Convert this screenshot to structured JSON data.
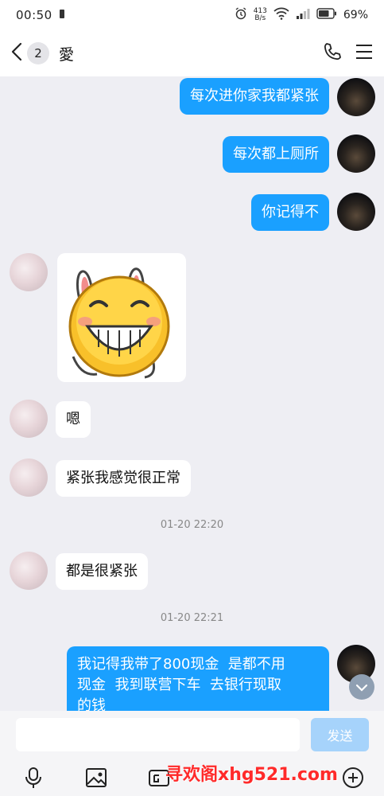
{
  "status_bar": {
    "time": "00:50",
    "net_speed_value": "413",
    "net_speed_unit": "B/s",
    "battery": "69%"
  },
  "header": {
    "unread_count": "2",
    "contact_name": "愛"
  },
  "messages": [
    {
      "side": "out",
      "text": "每次进你家我都紧张"
    },
    {
      "side": "out",
      "text": "每次都上厕所"
    },
    {
      "side": "out",
      "text": "你记得不"
    },
    {
      "side": "in",
      "type": "sticker",
      "sticker": "grinning-bunny-emoji"
    },
    {
      "side": "in",
      "text": "嗯"
    },
    {
      "side": "in",
      "text": "紧张我感觉很正常"
    },
    {
      "side": "in",
      "text": "都是很紧张"
    },
    {
      "side": "out",
      "text": "我记得我带了800现金  是都不用\n现金  我到联营下车  去银行现取\n的钱"
    }
  ],
  "timestamps": [
    "01-20 22:20",
    "01-20 22:21"
  ],
  "input": {
    "value": "",
    "placeholder": "",
    "send_label": "发送"
  },
  "toolbar": {
    "icons": [
      "microphone-icon",
      "image-icon",
      "gif-icon",
      "watermark",
      "add-icon"
    ]
  },
  "watermark": "寻欢阁xhg521.com",
  "colors": {
    "outgoing_bubble": "#1aa0ff",
    "incoming_bubble": "#ffffff",
    "chat_background": "#eeeef3",
    "send_button": "#a6d3fb"
  }
}
